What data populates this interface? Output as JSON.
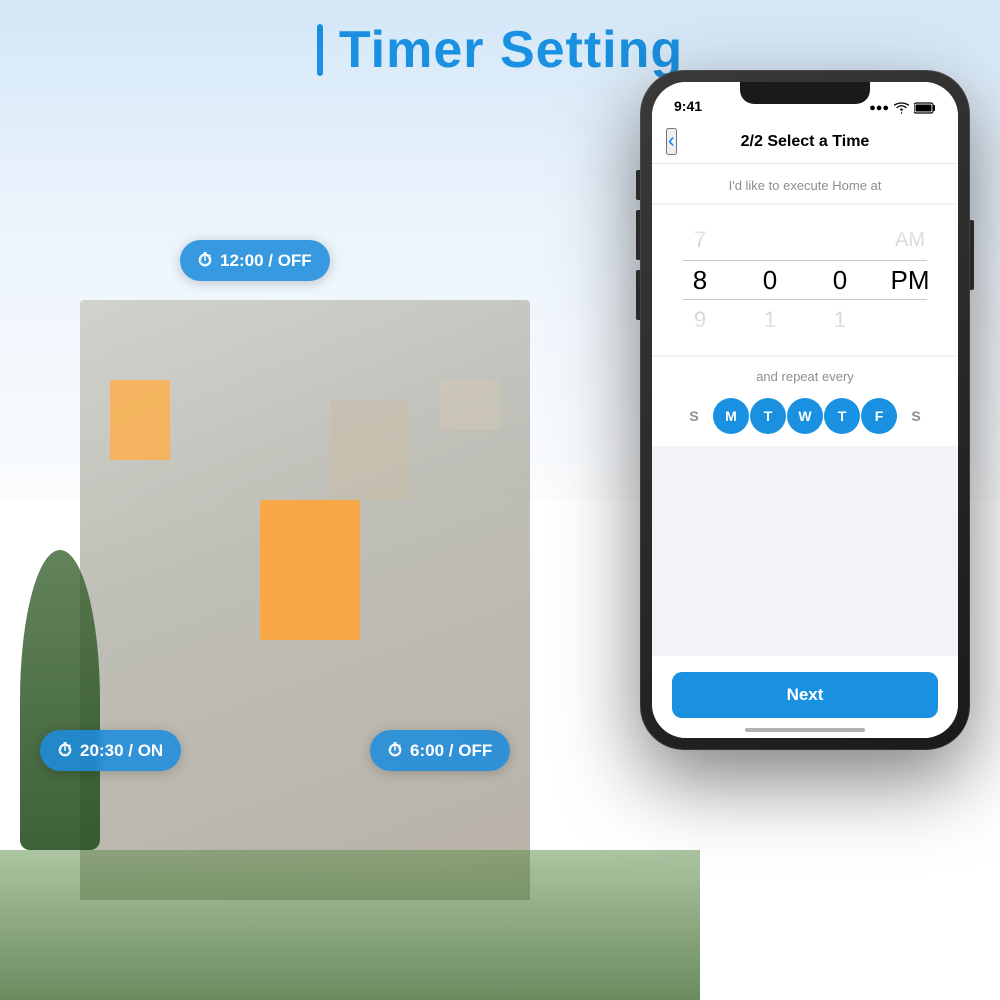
{
  "page": {
    "title": "Timer Setting",
    "title_accent": "|"
  },
  "badges": [
    {
      "id": "badge-1",
      "time": "12:00",
      "state": "OFF",
      "position": "top-right"
    },
    {
      "id": "badge-2",
      "time": "20:30",
      "state": "ON",
      "position": "bottom-left"
    },
    {
      "id": "badge-3",
      "time": "6:00",
      "state": "OFF",
      "position": "bottom-middle"
    }
  ],
  "phone": {
    "status_bar": {
      "time": "9:41",
      "signal": "●●●",
      "wifi": "WiFi",
      "battery": "Battery"
    },
    "header": {
      "back_label": "‹",
      "title": "2/2 Select a Time"
    },
    "execute_text": "I'd like to execute Home at",
    "time_picker": {
      "columns": [
        {
          "id": "hours",
          "items": [
            "7",
            "8",
            "9"
          ],
          "selected_index": 1
        },
        {
          "id": "minutes",
          "items": [
            "…",
            "0",
            "1",
            "…"
          ],
          "selected_index": 1
        },
        {
          "id": "seconds",
          "items": [
            "…",
            "0",
            "1",
            "…"
          ],
          "selected_index": 1
        },
        {
          "id": "ampm",
          "items": [
            "AM",
            "PM"
          ],
          "selected_index": 1
        }
      ]
    },
    "repeat_label": "and repeat every",
    "days": [
      {
        "label": "S",
        "active": false
      },
      {
        "label": "M",
        "active": true
      },
      {
        "label": "T",
        "active": true
      },
      {
        "label": "W",
        "active": true
      },
      {
        "label": "T",
        "active": true
      },
      {
        "label": "F",
        "active": true
      },
      {
        "label": "S",
        "active": false
      }
    ],
    "next_button": "Next"
  },
  "colors": {
    "accent_blue": "#1a90e0",
    "inactive_day": "#8e8e93",
    "active_day_bg": "#1a90e0"
  }
}
